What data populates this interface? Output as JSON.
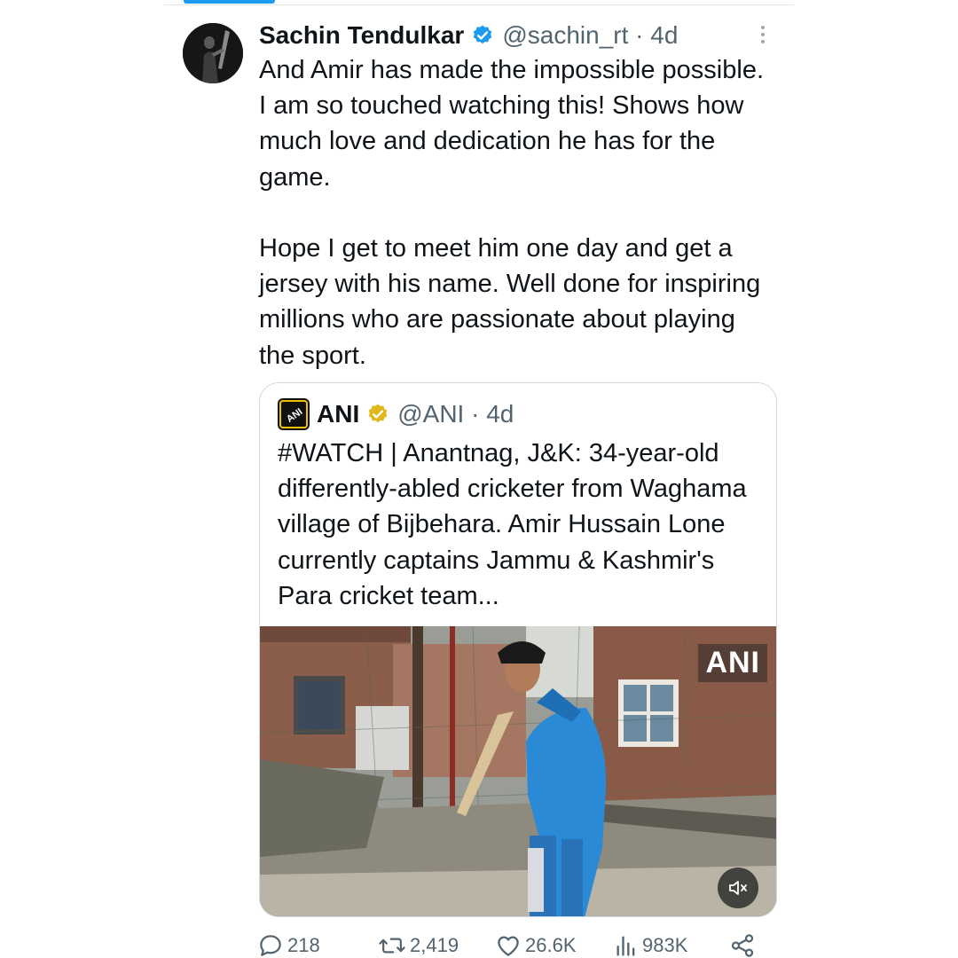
{
  "tweet": {
    "author_name": "Sachin Tendulkar",
    "handle_and_time": "@sachin_rt · 4d",
    "text": "And Amir has made the impossible possible. I am so touched watching this! Shows how much love and dedication he has for the game.\n\nHope I get to meet him one day and get a jersey with his name. Well done for inspiring millions who are passionate about playing the sport."
  },
  "quoted": {
    "author_name": "ANI",
    "handle_and_time": "@ANI · 4d",
    "text": "#WATCH | Anantnag, J&K: 34-year-old differently-abled cricketer from Waghama village of Bijbehara. Amir Hussain Lone currently captains Jammu & Kashmir's Para cricket team...",
    "video_watermark": "ANI",
    "logo_text": "ANI"
  },
  "actions": {
    "replies": "218",
    "reposts": "2,419",
    "likes": "26.6K",
    "views": "983K"
  },
  "colors": {
    "verified_blue": "#1d9bf0",
    "verified_gold": "#e2b719",
    "secondary_text": "#536471",
    "border": "#cfd9de"
  },
  "icons": [
    "reply-icon",
    "repost-icon",
    "like-icon",
    "views-icon",
    "share-icon",
    "more-icon",
    "mute-icon",
    "verified-badge-icon"
  ]
}
